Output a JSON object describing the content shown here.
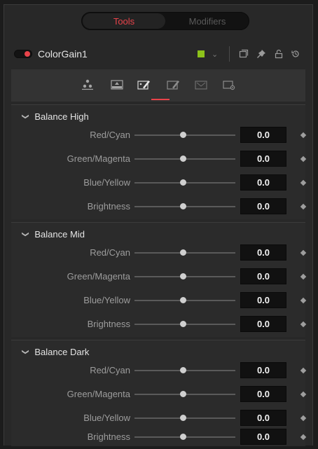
{
  "window": {
    "mode_tabs": [
      {
        "label": "Tools",
        "active": true
      },
      {
        "label": "Modifiers",
        "active": false
      }
    ],
    "accent_color": "#e8434a",
    "tool_color_swatch": "#8cc21a"
  },
  "tool": {
    "name": "ColorGain1",
    "icons": [
      "power-toggle-icon",
      "color-swatch-icon",
      "chevron-down-icon",
      "window-icon",
      "pin-icon",
      "lock-icon",
      "reset-icon"
    ]
  },
  "tab_icons": [
    "gain-icon",
    "saturation-icon",
    "color-balance-icon",
    "hue-icon",
    "ranges-icon",
    "settings-icon"
  ],
  "sections": [
    {
      "title": "Balance High",
      "rows": [
        {
          "label": "Red/Cyan",
          "value": "0.0"
        },
        {
          "label": "Green/Magenta",
          "value": "0.0"
        },
        {
          "label": "Blue/Yellow",
          "value": "0.0"
        },
        {
          "label": "Brightness",
          "value": "0.0"
        }
      ]
    },
    {
      "title": "Balance Mid",
      "rows": [
        {
          "label": "Red/Cyan",
          "value": "0.0"
        },
        {
          "label": "Green/Magenta",
          "value": "0.0"
        },
        {
          "label": "Blue/Yellow",
          "value": "0.0"
        },
        {
          "label": "Brightness",
          "value": "0.0"
        }
      ]
    },
    {
      "title": "Balance Dark",
      "rows": [
        {
          "label": "Red/Cyan",
          "value": "0.0"
        },
        {
          "label": "Green/Magenta",
          "value": "0.0"
        },
        {
          "label": "Blue/Yellow",
          "value": "0.0"
        },
        {
          "label": "Brightness",
          "value": "0.0"
        }
      ]
    }
  ]
}
